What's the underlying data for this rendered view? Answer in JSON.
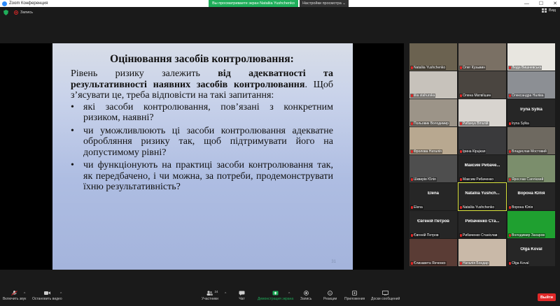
{
  "window": {
    "title": "Zoom Конференция",
    "share_banner": "Вы просматриваете экран Nataliia Yushchenko",
    "view_options": "Настройки просмотра",
    "minimize": "—",
    "maximize": "☐",
    "close": "✕"
  },
  "topbar": {
    "record_label": "Запись",
    "view_label": "Вид"
  },
  "slide": {
    "title": "Оцінювання засобів контролювання:",
    "intro_plain_1": "Рівень ризику залежить ",
    "intro_bold": "від адекватності та результативності наявних засобів контролювання",
    "intro_plain_2": ". Щоб з’ясувати це, треба відповісти на такі запитання:",
    "bullets": [
      "які засоби контролювання, пов’язані з конкретним ризиком, наявні?",
      "чи уможливлюють ці засоби контролювання адекватне обробляння ризику так, щоб підтримувати його на допустимому рівні?",
      "чи функціонують на практиці засоби контролювання так, як передбачено, і чи можна, за потреби, продемонструвати їхню результативність?"
    ],
    "page_number": "31"
  },
  "participants": [
    {
      "label": "Nataliia Yushchenko",
      "center": "",
      "color": "#6b6250"
    },
    {
      "label": "Олег Кузьмин",
      "center": "",
      "color": "#7a7064"
    },
    {
      "label": "Люда Вишневська",
      "center": "",
      "color": "#e8e6e0"
    },
    {
      "label": "lilia stahurska",
      "center": "",
      "color": "#c7c2bb"
    },
    {
      "label": "Олена Матвіїшин",
      "center": "",
      "color": "#4a4540"
    },
    {
      "label": "Олександра Наліва",
      "center": "",
      "color": "#8c8f94"
    },
    {
      "label": "Польовик Володимир",
      "center": "",
      "color": "#9c9488"
    },
    {
      "label": "Рибачук Віталій",
      "center": "",
      "color": "#d8d4cf"
    },
    {
      "label": "Iryna Sylka",
      "center": "Iryna Sylka",
      "color": "#262626"
    },
    {
      "label": "Фролова Наталія",
      "center": "",
      "color": "#b8a890"
    },
    {
      "label": "Ірина Кірцікая",
      "center": "",
      "color": "#3a3a3c"
    },
    {
      "label": "Владислав Мостовий",
      "center": "",
      "color": "#6e6960"
    },
    {
      "label": "Шквирів Юлія",
      "center": "",
      "color": "#4e4e4e"
    },
    {
      "label": "Максим Рибаченко",
      "center": "Максим Рибаче...",
      "color": "#262626"
    },
    {
      "label": "Ярослав Саплієвий",
      "center": "",
      "color": "#7b8e6c"
    },
    {
      "label": "Elena",
      "center": "Elena",
      "color": "#262626"
    },
    {
      "label": "Nataliia Yushchenko",
      "center": "Nataliia Yushch...",
      "color": "#262626"
    },
    {
      "label": "Ворона Юлія",
      "center": "Ворона Юлія",
      "color": "#262626"
    },
    {
      "label": "Євгеній Петров",
      "center": "Євгеній Петров",
      "color": "#262626"
    },
    {
      "label": "Рибаченко Станіслав",
      "center": "Рибаченко Ста...",
      "color": "#262626"
    },
    {
      "label": "Володимир Захаров",
      "center": "",
      "color": "#1fa030"
    },
    {
      "label": "Єлизавета Янченко",
      "center": "",
      "color": "#5a3c35"
    },
    {
      "label": "Наталія Бондар",
      "center": "",
      "color": "#c9b9a8"
    },
    {
      "label": "Olga Koval",
      "center": "Olga Koval",
      "color": "#262626"
    }
  ],
  "toolbar": {
    "audio": "Включить звук",
    "video": "Остановить видео",
    "participants": "Участники",
    "participants_count": "24",
    "chat": "Чат",
    "share": "Демонстрация экрана",
    "record": "Запись",
    "reactions": "Реакции",
    "apps": "Приложения",
    "docs": "Доски сообщений",
    "end": "Выйти"
  },
  "colors": {
    "share_green": "#1fae5a",
    "end_red": "#e02828",
    "active_speaker": "#d8e23a"
  }
}
